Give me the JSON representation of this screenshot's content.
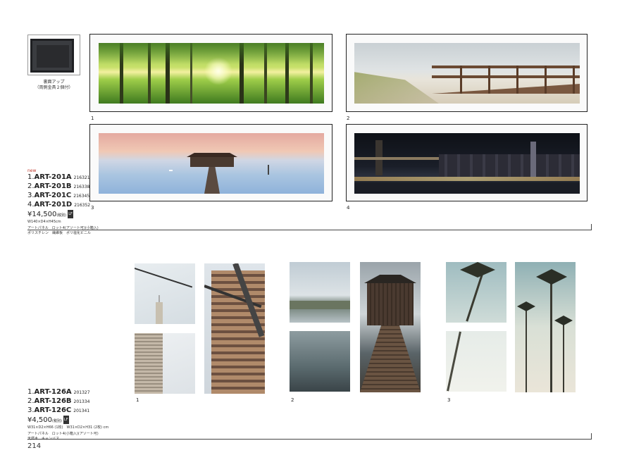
{
  "top_section": {
    "back_caption": [
      "裏面アップ",
      "（両側金具２個付）"
    ],
    "image_numbers": [
      "1",
      "2",
      "3",
      "4"
    ],
    "new_label": "new",
    "products": [
      {
        "prefix": "1.",
        "code": "ART-201A",
        "jan": "216321"
      },
      {
        "prefix": "2.",
        "code": "ART-201B",
        "jan": "216338"
      },
      {
        "prefix": "3.",
        "code": "ART-201C",
        "jan": "216345"
      },
      {
        "prefix": "4.",
        "code": "ART-201D",
        "jan": "216352"
      }
    ],
    "price": "¥14,500",
    "price_tax": "(税別)",
    "badge": "LF",
    "size": "W140×D4×H45cm",
    "spec_line1": "アートパネル　ロット4(アソート可)(小箱入)",
    "spec_line2": "ポリスチレン　繊維板　ポリ塩化ビニル"
  },
  "bottom_section": {
    "image_numbers": [
      "1",
      "2",
      "3"
    ],
    "products": [
      {
        "prefix": "1.",
        "code": "ART-126A",
        "jan": "201327"
      },
      {
        "prefix": "2.",
        "code": "ART-126B",
        "jan": "201334"
      },
      {
        "prefix": "3.",
        "code": "ART-126C",
        "jan": "201341"
      }
    ],
    "price": "¥4,500",
    "price_tax": "(税別)",
    "badge": "LF",
    "size": "W31×D2×H66 (1枚)　W31×D2×H31 (2枚) cm",
    "spec_line1": "アートパネル　ロット4(小箱入)(アソート可)",
    "spec_line2": "天然木　キャンバス"
  },
  "page_number": "214"
}
